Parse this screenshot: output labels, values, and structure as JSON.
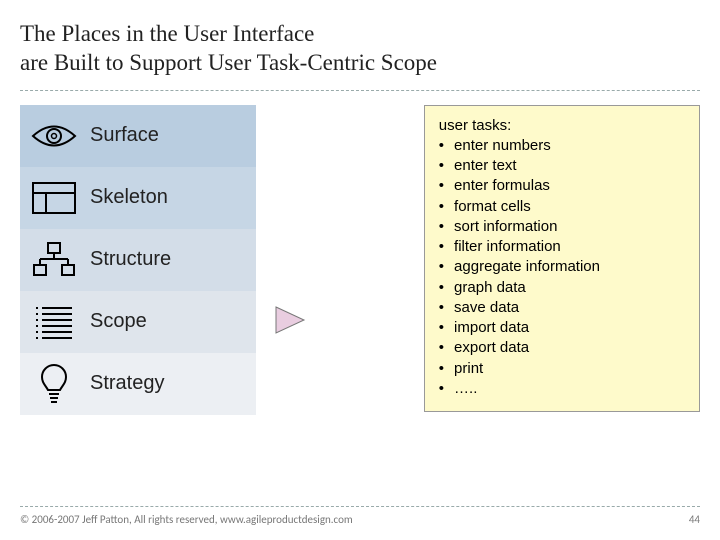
{
  "title_line1": "The Places in the User Interface",
  "title_line2": "are Built to Support User Task-Centric Scope",
  "planes": {
    "surface": "Surface",
    "skeleton": "Skeleton",
    "structure": "Structure",
    "scope": "Scope",
    "strategy": "Strategy"
  },
  "tasks_heading": "user tasks:",
  "tasks": [
    "enter numbers",
    "enter text",
    "enter formulas",
    "format cells",
    "sort information",
    "filter information",
    "aggregate information",
    "graph data",
    "save data",
    "import data",
    "export data",
    "print",
    "….."
  ],
  "footer_left": "© 2006-2007 Jeff Patton, All rights reserved, www.agileproductdesign.com",
  "footer_right": "44"
}
